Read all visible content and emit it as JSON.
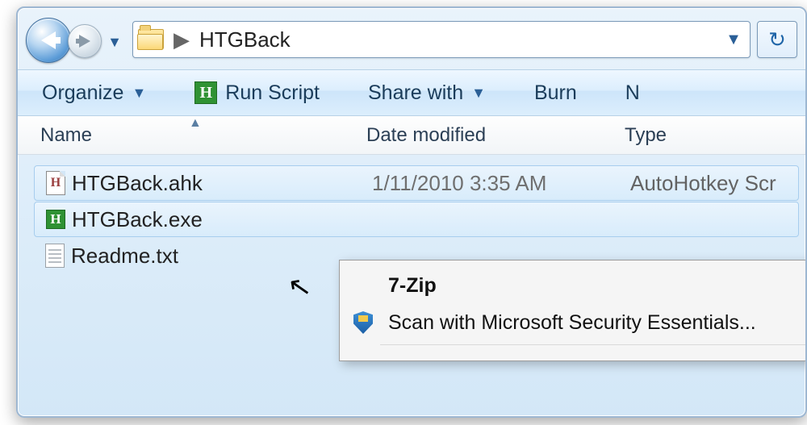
{
  "address": {
    "folder": "HTGBack",
    "separator": "▶"
  },
  "toolbar": {
    "organize": "Organize",
    "run_script": "Run Script",
    "share_with": "Share with",
    "burn": "Burn",
    "next_trunc": "N"
  },
  "columns": {
    "name": "Name",
    "date": "Date modified",
    "type": "Type"
  },
  "files": [
    {
      "name": "HTGBack.ahk",
      "date": "1/11/2010 3:35 AM",
      "type": "AutoHotkey Scr",
      "icon": "ahk-doc",
      "selected": true
    },
    {
      "name": "HTGBack.exe",
      "date": "",
      "type": "",
      "icon": "ahk-exe",
      "selected": true
    },
    {
      "name": "Readme.txt",
      "date": "",
      "type": "",
      "icon": "txt",
      "selected": false
    }
  ],
  "context_menu": {
    "item1": "7-Zip",
    "item2": "Scan with Microsoft Security Essentials..."
  }
}
